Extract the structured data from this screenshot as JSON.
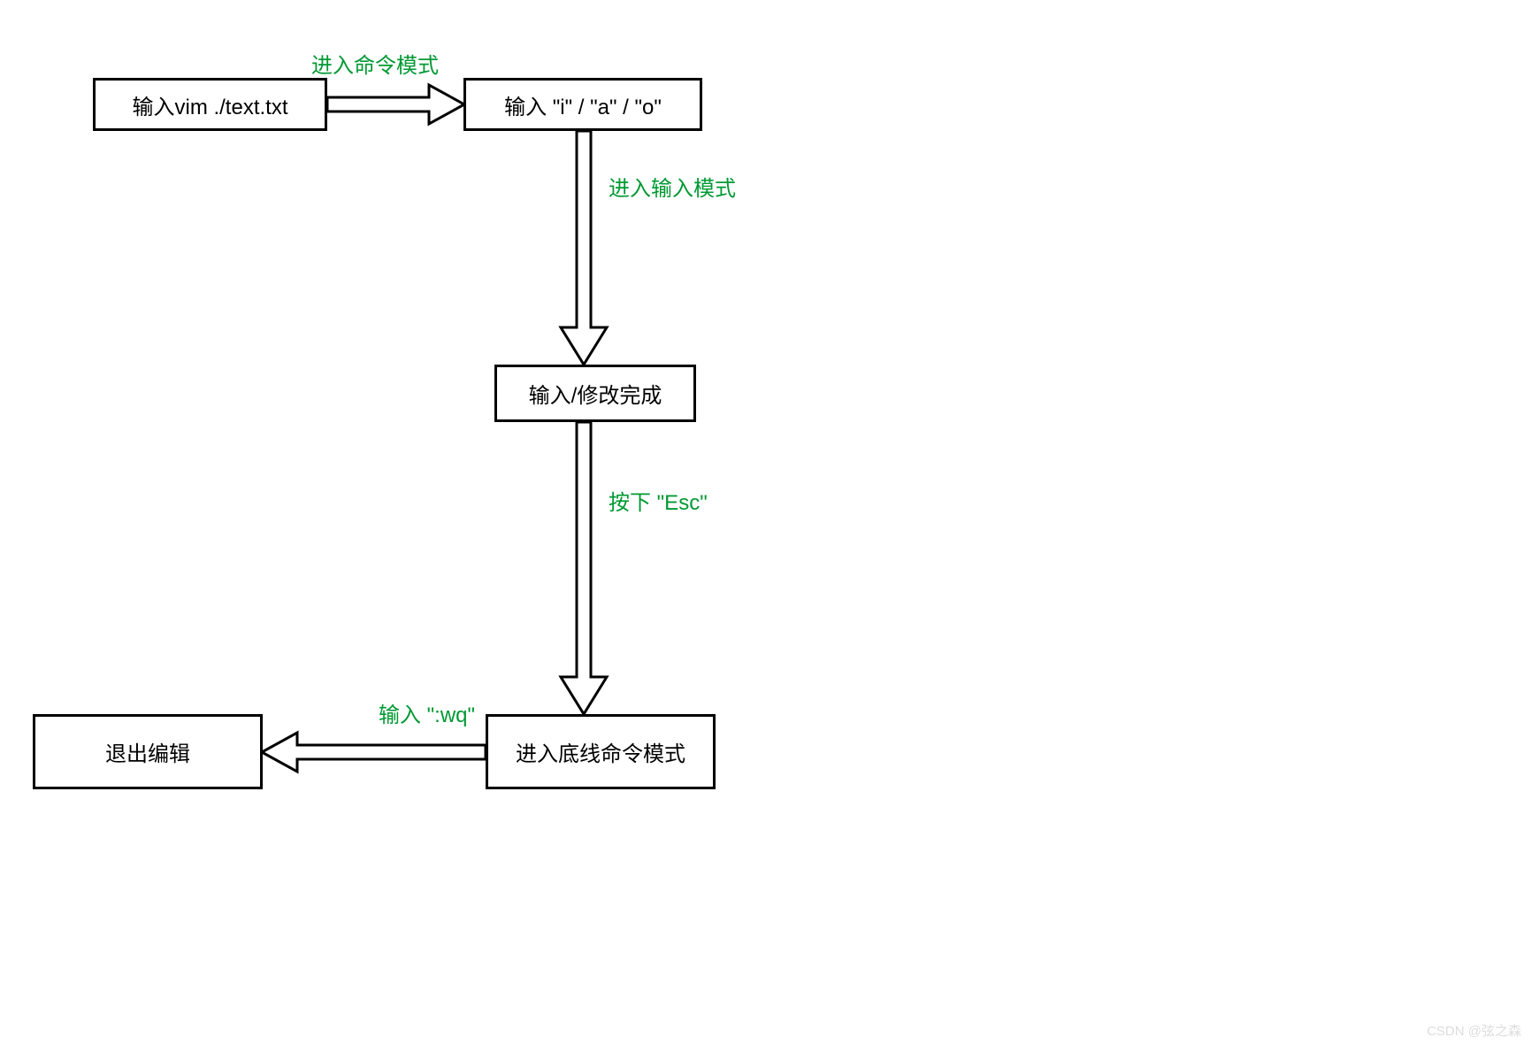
{
  "boxes": {
    "vim_command": "输入vim ./text.txt",
    "enter_insert_keys": "输入 \"i\" / \"a\" / \"o\"",
    "done_editing": "输入/修改完成",
    "bottom_line_mode": "进入底线命令模式",
    "exit_editor": "退出编辑"
  },
  "edges": {
    "to_command_mode": "进入命令模式",
    "to_insert_mode": "进入输入模式",
    "press_esc": "按下 \"Esc\"",
    "type_wq": "输入 \":wq\""
  },
  "watermark": "CSDN @弦之森"
}
